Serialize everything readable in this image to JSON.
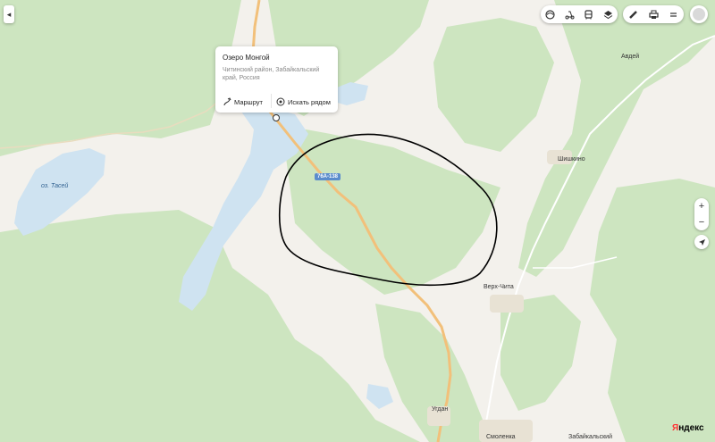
{
  "map": {
    "colors": {
      "land": "#f3f1ec",
      "forest": "#cde5c0",
      "water": "#cfe3f1",
      "road": "#f2c07a",
      "drawn_path": "#000000"
    },
    "road_number": "76А-138",
    "water_labels": {
      "lake_tasei": "оз. Тасей"
    },
    "places": {
      "avdei": "Авдей",
      "shishkino": "Шишкино",
      "verkh_chita": "Верх-Чита",
      "ugdan": "Угдан",
      "smolenka": "Смоленка",
      "zabaikalsky": "Забайкальский"
    }
  },
  "popup": {
    "title": "Озеро Монгой",
    "address": "Читинский район, Забайкальский край, Россия",
    "route_label": "Маршрут",
    "search_nearby_label": "Искать рядом"
  },
  "toolbar": {
    "left_icons": [
      "panorama-icon",
      "scooter-icon",
      "bus-icon",
      "layers-icon"
    ],
    "right_icons": [
      "ruler-icon",
      "print-icon",
      "menu-icon"
    ]
  },
  "controls": {
    "zoom_in": "+",
    "zoom_out": "−"
  },
  "logo": {
    "first": "Я",
    "rest": "ндекс"
  }
}
